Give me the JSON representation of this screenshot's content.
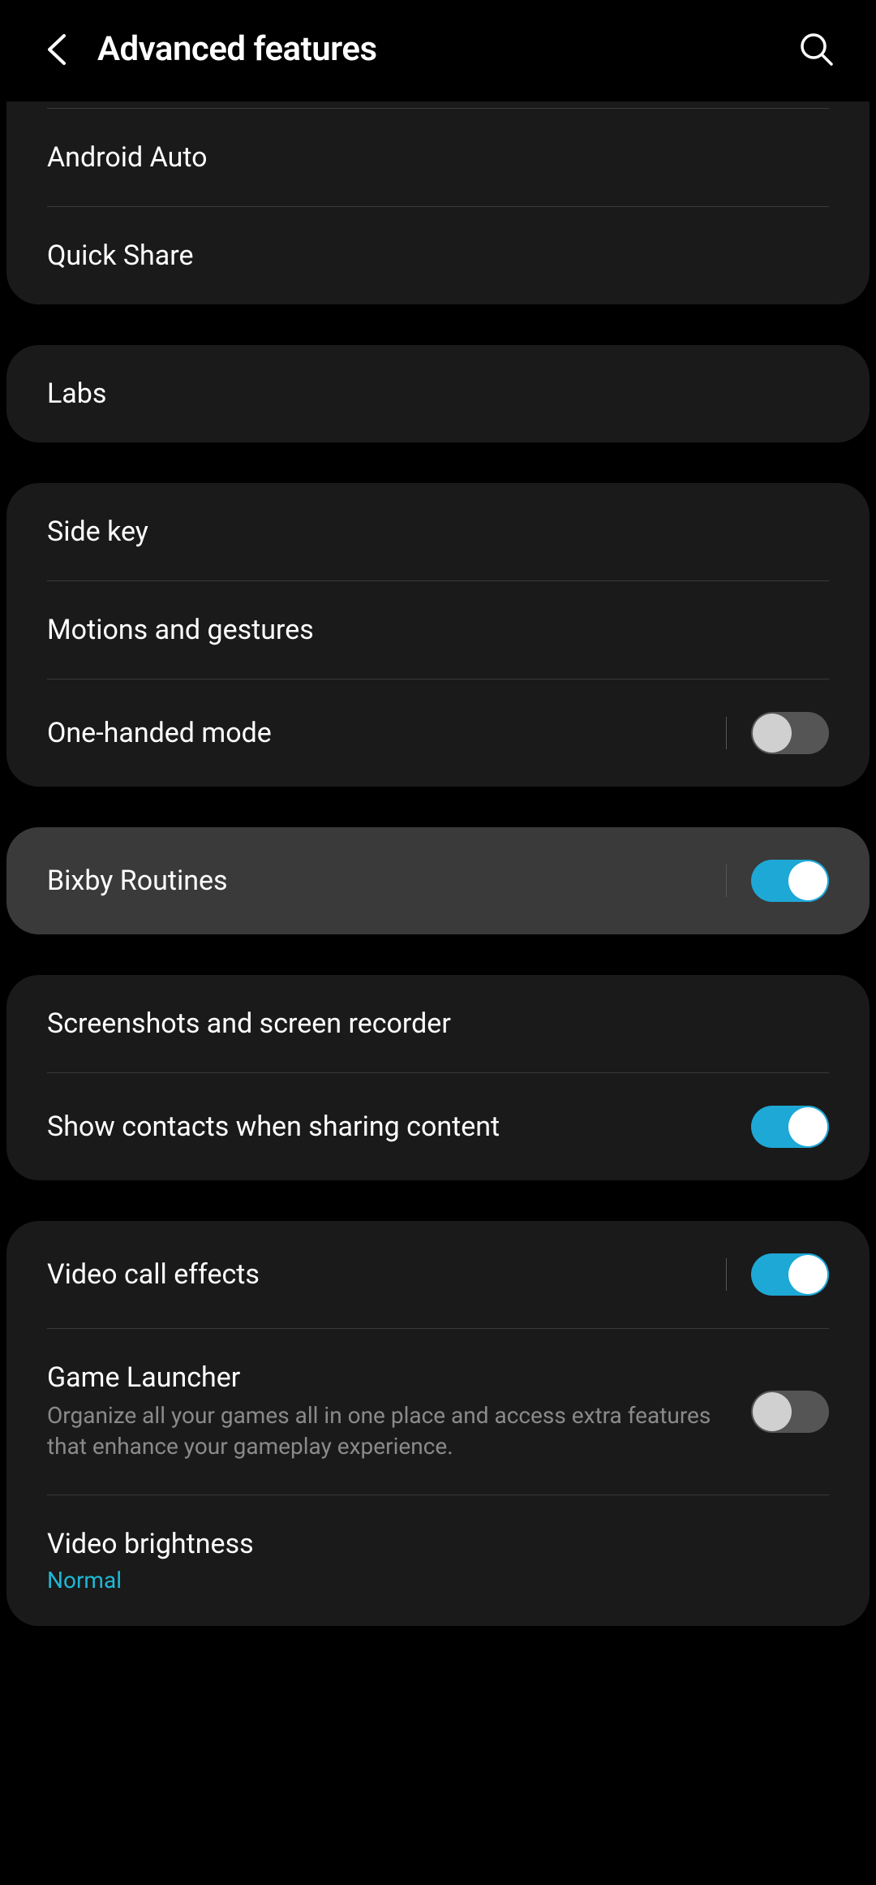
{
  "header": {
    "title": "Advanced features"
  },
  "groups": [
    {
      "items": [
        {
          "label": "Android Auto"
        },
        {
          "label": "Quick Share"
        }
      ]
    },
    {
      "items": [
        {
          "label": "Labs"
        }
      ]
    },
    {
      "items": [
        {
          "label": "Side key"
        },
        {
          "label": "Motions and gestures"
        },
        {
          "label": "One-handed mode",
          "toggle": false,
          "divider": true
        }
      ]
    },
    {
      "highlighted": true,
      "items": [
        {
          "label": "Bixby Routines",
          "toggle": true,
          "divider": true
        }
      ]
    },
    {
      "items": [
        {
          "label": "Screenshots and screen recorder"
        },
        {
          "label": "Show contacts when sharing content",
          "toggle": true
        }
      ]
    },
    {
      "items": [
        {
          "label": "Video call effects",
          "toggle": true,
          "divider": true
        },
        {
          "label": "Game Launcher",
          "description": "Organize all your games all in one place and access extra features that enhance your gameplay experience.",
          "toggle": false
        },
        {
          "label": "Video brightness",
          "subvalue": "Normal"
        }
      ]
    }
  ]
}
